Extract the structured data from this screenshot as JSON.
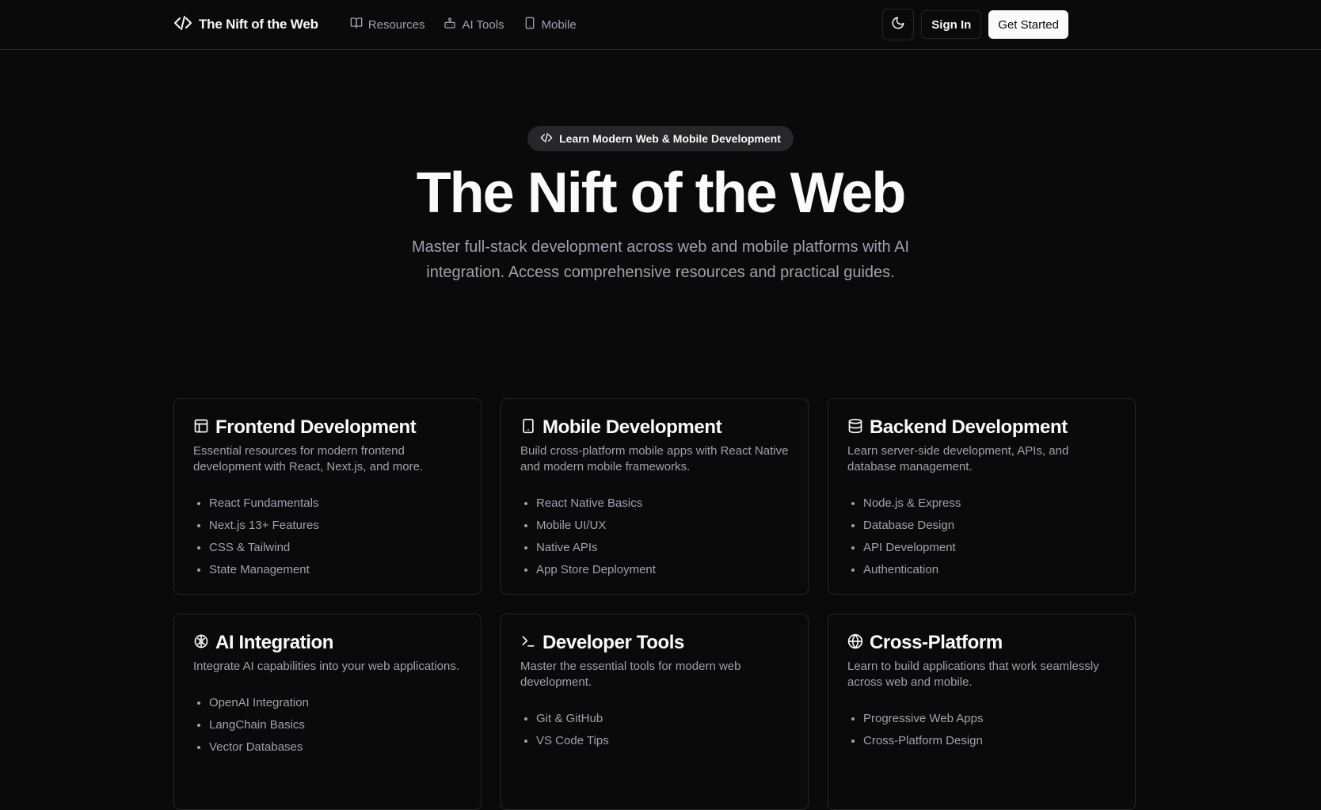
{
  "header": {
    "brand": "The Nift of the Web",
    "nav": [
      {
        "label": "Resources",
        "icon": "book-icon"
      },
      {
        "label": "AI Tools",
        "icon": "bot-icon"
      },
      {
        "label": "Mobile",
        "icon": "smartphone-icon"
      }
    ],
    "theme_toggle_icon": "moon-icon",
    "signin_label": "Sign In",
    "get_started_label": "Get Started"
  },
  "hero": {
    "badge": "Learn Modern Web & Mobile Development",
    "title": "The Nift of the Web",
    "subtitle": "Master full-stack development across web and mobile platforms with AI integration. Access comprehensive resources and practical guides."
  },
  "cards": [
    {
      "icon": "layout-icon",
      "title": "Frontend Development",
      "description": "Essential resources for modern frontend development with React, Next.js, and more.",
      "items": [
        "React Fundamentals",
        "Next.js 13+ Features",
        "CSS & Tailwind",
        "State Management"
      ]
    },
    {
      "icon": "smartphone-icon",
      "title": "Mobile Development",
      "description": "Build cross-platform mobile apps with React Native and modern mobile frameworks.",
      "items": [
        "React Native Basics",
        "Mobile UI/UX",
        "Native APIs",
        "App Store Deployment"
      ]
    },
    {
      "icon": "database-icon",
      "title": "Backend Development",
      "description": "Learn server-side development, APIs, and database management.",
      "items": [
        "Node.js & Express",
        "Database Design",
        "API Development",
        "Authentication"
      ]
    },
    {
      "icon": "brain-icon",
      "title": "AI Integration",
      "description": "Integrate AI capabilities into your web applications.",
      "items": [
        "OpenAI Integration",
        "LangChain Basics",
        "Vector Databases"
      ]
    },
    {
      "icon": "terminal-icon",
      "title": "Developer Tools",
      "description": "Master the essential tools for modern web development.",
      "items": [
        "Git & GitHub",
        "VS Code Tips"
      ]
    },
    {
      "icon": "globe-icon",
      "title": "Cross-Platform",
      "description": "Learn to build applications that work seamlessly across web and mobile.",
      "items": [
        "Progressive Web Apps",
        "Cross-Platform Design"
      ]
    }
  ]
}
